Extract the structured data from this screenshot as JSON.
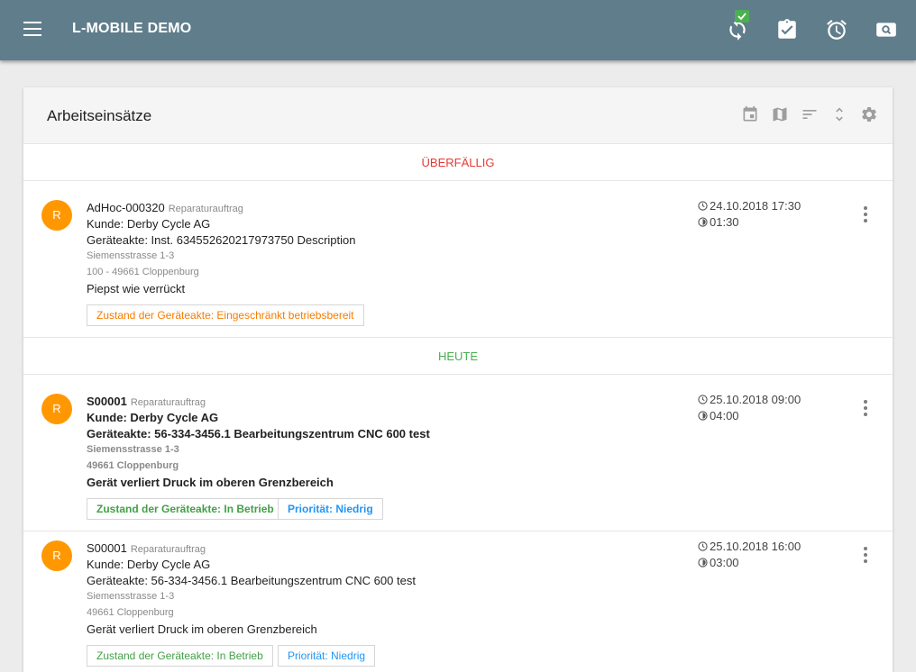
{
  "appbar": {
    "title": "L-MOBILE DEMO",
    "color": "#607d8b",
    "icons": [
      "menu-icon",
      "sync-icon",
      "clipboard-check-icon",
      "alarm-icon",
      "photo-search-icon"
    ]
  },
  "card": {
    "title": "Arbeitseinsätze",
    "header_icons": [
      "calendar-icon",
      "map-icon",
      "sort-icon",
      "expand-icon",
      "gear-icon"
    ]
  },
  "sections": {
    "overdue": {
      "label": "ÜBERFÄLLIG",
      "color": "#e53935"
    },
    "today": {
      "label": "HEUTE",
      "color": "#4caf50"
    }
  },
  "items": [
    {
      "avatar": "R",
      "id": "AdHoc-000320",
      "type": "Reparaturauftrag",
      "customer": "Kunde: Derby Cycle AG",
      "device": "Geräteakte: Inst. 634552620217973750 Description",
      "street": "Siemensstrasse 1-3",
      "city": "100 - 49661 Cloppenburg",
      "note": "Piepst wie verrückt",
      "datetime": "24.10.2018 17:30",
      "duration": "01:30",
      "tags": [
        "Zustand der Geräteakte: Eingeschränkt betriebsbereit"
      ]
    },
    {
      "avatar": "R",
      "id": "S00001",
      "type": "Reparaturauftrag",
      "customer": "Kunde: Derby Cycle AG",
      "device": "Geräteakte: 56-334-3456.1 Bearbeitungszentrum CNC 600 test",
      "street": "Siemensstrasse 1-3",
      "city": "49661 Cloppenburg",
      "note": "Gerät verliert Druck im oberen Grenzbereich",
      "datetime": "25.10.2018 09:00",
      "duration": "04:00",
      "tags": [
        "Zustand der Geräteakte: In Betrieb",
        "Priorität: Niedrig"
      ]
    },
    {
      "avatar": "R",
      "id": "S00001",
      "type": "Reparaturauftrag",
      "customer": "Kunde: Derby Cycle AG",
      "device": "Geräteakte: 56-334-3456.1 Bearbeitungszentrum CNC 600 test",
      "street": "Siemensstrasse 1-3",
      "city": "49661 Cloppenburg",
      "note": "Gerät verliert Druck im oberen Grenzbereich",
      "datetime": "25.10.2018 16:00",
      "duration": "03:00",
      "tags": [
        "Zustand der Geräteakte: In Betrieb",
        "Priorität: Niedrig"
      ]
    }
  ],
  "colors": {
    "avatar": "#ff9800",
    "tag_orange": "#f57c00",
    "tag_green": "#43a047",
    "tag_blue": "#2196f3"
  }
}
